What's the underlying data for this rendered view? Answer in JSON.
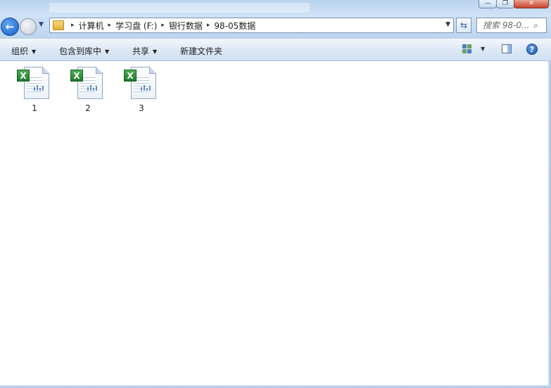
{
  "window": {
    "minimize_glyph": "—",
    "maximize_glyph": "❐",
    "close_glyph": "✕"
  },
  "nav": {
    "back_glyph": "←",
    "history_glyph": "▼"
  },
  "address": {
    "breadcrumbs": [
      "计算机",
      "学习盘 (F:)",
      "银行数据",
      "98-05数据"
    ],
    "separator": "▸",
    "dropdown_glyph": "▼",
    "refresh_glyph": "⇆"
  },
  "search": {
    "placeholder": "搜索 98-0...",
    "icon": "search-icon"
  },
  "toolbar": {
    "organize": "组织",
    "include_in_library": "包含到库中",
    "share": "共享",
    "new_folder": "新建文件夹",
    "caret": "▼",
    "help": "?"
  },
  "files": [
    {
      "name": "1",
      "type": "excel-file-icon"
    },
    {
      "name": "2",
      "type": "excel-file-icon"
    },
    {
      "name": "3",
      "type": "excel-file-icon"
    }
  ],
  "excel_badge_letter": "X",
  "colors": {
    "accent": "#1b5ec4",
    "excel_green": "#1f7a2c",
    "command_bar": "#dbe7f5"
  }
}
